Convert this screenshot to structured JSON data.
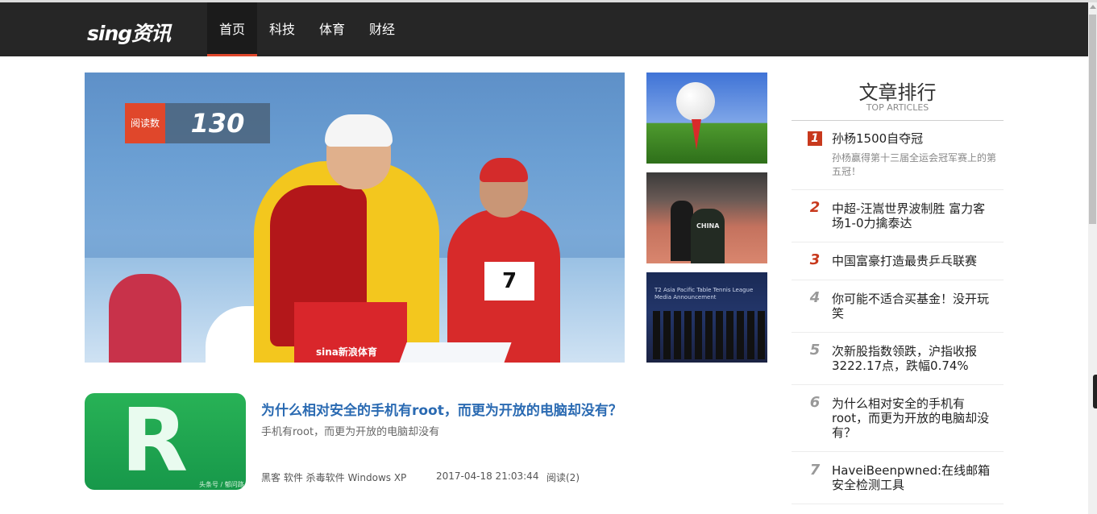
{
  "header": {
    "logo": "sing资讯",
    "nav": [
      {
        "label": "首页",
        "active": true
      },
      {
        "label": "科技",
        "active": false
      },
      {
        "label": "体育",
        "active": false
      },
      {
        "label": "财经",
        "active": false
      }
    ],
    "background": "#262626",
    "accent": "#e0472b"
  },
  "hero": {
    "read_label": "阅读数",
    "read_count": "130",
    "bib_number": "7",
    "watermark": "sina新浪体育"
  },
  "thumbnails": [
    {
      "icon": "golf-ball-photo"
    },
    {
      "icon": "table-tennis-photo",
      "jersey_text": "CHINA"
    },
    {
      "icon": "team-photo",
      "banner_text": "T2 Asia Pacific Table Tennis League Media Announcement"
    }
  ],
  "article": {
    "title": "为什么相对安全的手机有root，而更为开放的电脑却没有？",
    "summary": "手机有root，而更为开放的电脑却没有",
    "tags": "黑客 软件 杀毒软件 Windows XP",
    "date": "2017-04-18 21:03:44",
    "reads": "阅读(2)",
    "image_letter": "R",
    "image_watermark": "头条号 / 郁问路"
  },
  "ranking": {
    "title": "文章排行",
    "subtitle": "TOP ARTICLES",
    "items": [
      {
        "rank": "1",
        "title": "孙杨1500自夺冠",
        "desc": "孙杨赢得第十三届全运会冠军赛上的第五冠！"
      },
      {
        "rank": "2",
        "title": "中超-汪嵩世界波制胜 富力客场1-0力擒泰达"
      },
      {
        "rank": "3",
        "title": "中国富豪打造最贵乒乓联赛"
      },
      {
        "rank": "4",
        "title": "你可能不适合买基金！没开玩笑"
      },
      {
        "rank": "5",
        "title": "次新股指数领跌，沪指收报3222.17点，跌幅0.74%"
      },
      {
        "rank": "6",
        "title": "为什么相对安全的手机有root，而更为开放的电脑却没有？"
      },
      {
        "rank": "7",
        "title": "HaveiBeenpwned:在线邮箱安全检测工具"
      }
    ]
  }
}
